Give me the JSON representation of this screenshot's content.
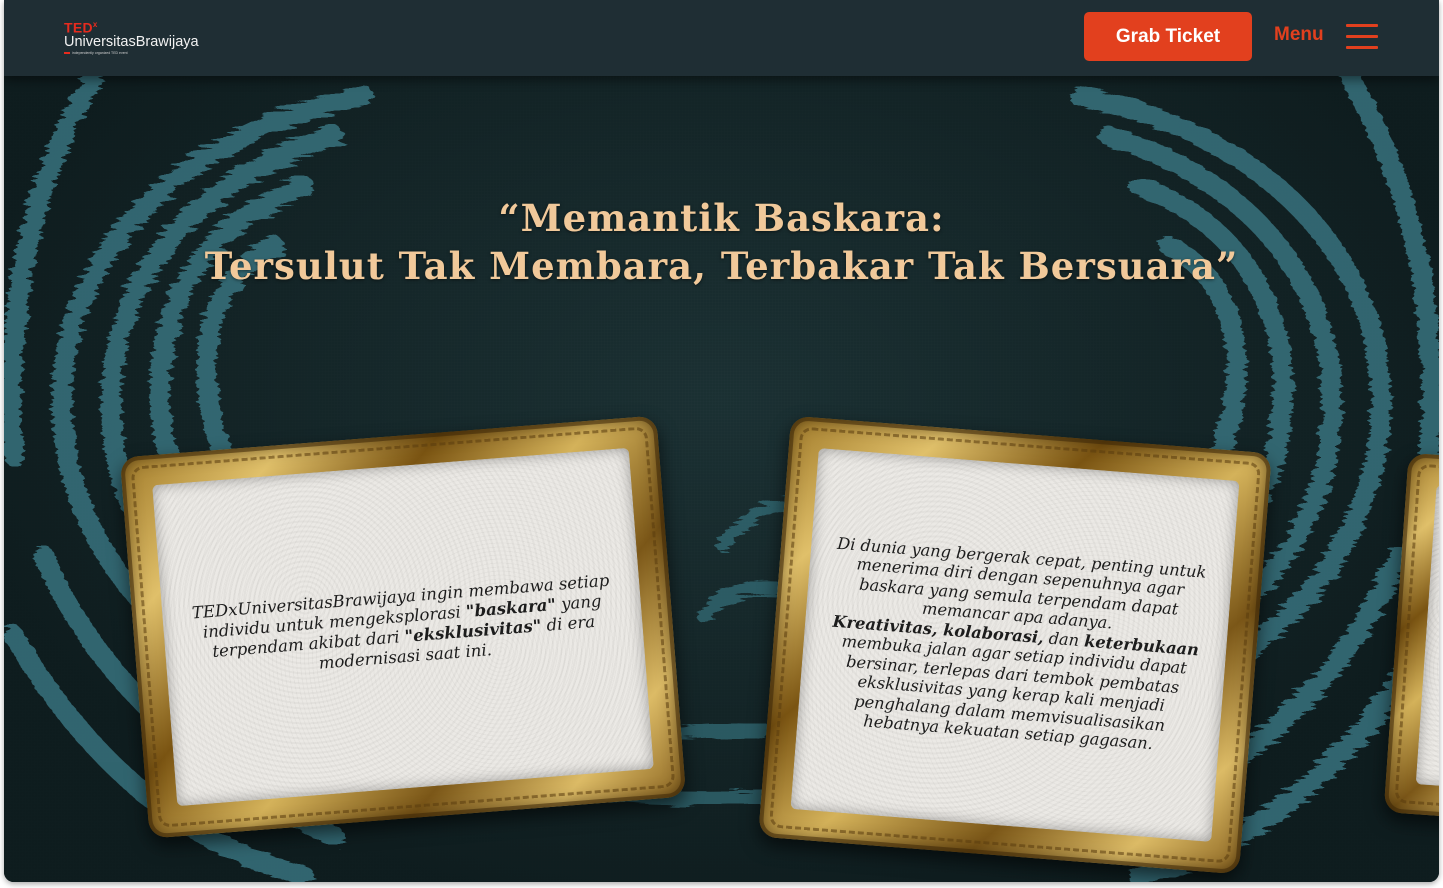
{
  "navbar": {
    "logo": {
      "ted": "TED",
      "x": "x",
      "name": "UniversitasBrawijaya",
      "tagline": "independently organized TED event"
    },
    "grab_ticket_label": "Grab Ticket",
    "menu_label": "Menu"
  },
  "hero": {
    "title_line1": "“Memantik Baskara:",
    "title_line2": "Tersulut Tak Membara, Terbakar Tak Bersuara”"
  },
  "frames": {
    "left": {
      "t1": "TEDxUniversitasBrawijaya ingin membawa setiap individu untuk mengeksplorasi ",
      "b1": "\"baskara\"",
      "t2": " yang terpendam akibat dari ",
      "b2": "\"eksklusivitas\"",
      "t3": " di era modernisasi saat ini."
    },
    "right": {
      "p1": "Di dunia yang bergerak cepat, penting untuk menerima diri dengan sepenuhnya agar baskara yang semula terpendam dapat memancar apa adanya.",
      "b1": "Kreativitas, kolaborasi,",
      "t1": " dan ",
      "b2": "keterbukaan",
      "t2": " membuka jalan agar setiap individu dapat bersinar, terlepas dari tembok pembatas eksklusivitas yang kerap kali menjadi penghalang dalam memvisualisasikan hebatnya kekuatan setiap gagasan."
    }
  },
  "colors": {
    "accent": "#e2401e",
    "navbar_bg": "#1f2e34",
    "title_gold": "#f1c99a",
    "swirl_teal": "#3d7d8a"
  }
}
